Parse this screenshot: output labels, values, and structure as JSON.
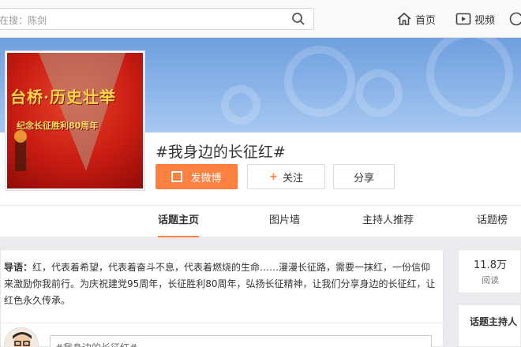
{
  "search": {
    "placeholder": "大家正在搜：陈剑",
    "visible_text": "在搜：陈剑"
  },
  "nav": {
    "home": "首页",
    "video": "视频"
  },
  "cover": {
    "title": "台桥·历史壮举",
    "subtitle": "纪念长征胜利80周年"
  },
  "topic": {
    "title": "#我身边的长征红#"
  },
  "buttons": {
    "post": "发微博",
    "follow": "关注",
    "share": "分享"
  },
  "tabs": [
    "话题主页",
    "图片墙",
    "主持人推荐",
    "话题榜"
  ],
  "intro": {
    "label": "导语：",
    "text": "红，代表着希望，代表着奋斗不息，代表着燃烧的生命……漫漫长征路，需要一抹红，一份信仰来激励你我前行。为庆祝建党95周年，长征胜利80周年，弘扬长征精神，让我们分享身边的长征红，让红色永久传承。"
  },
  "compose": {
    "text": "#我身边的长征红#"
  },
  "stats": {
    "reads": "11.8万",
    "reads_label": "阅读"
  },
  "sidebar": {
    "host_heading": "话题主持人"
  },
  "colors": {
    "accent": "#ff8140",
    "banner": "#8eb7ea"
  }
}
